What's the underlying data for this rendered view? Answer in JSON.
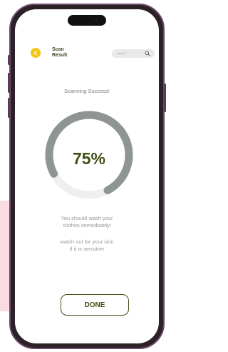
{
  "header": {
    "title_line1": "Scan",
    "title_line2": "Result",
    "search_placeholder": "search"
  },
  "status_text": "Scanning Success!",
  "progress": {
    "percent": 75,
    "label": "75%",
    "track_color": "#efefef",
    "fill_color": "#8f9594"
  },
  "messages": {
    "line1": "You should wash your",
    "line2": "clothes immediately!",
    "line3": "watch out for your skin",
    "line4": "if it is sensitive"
  },
  "done_label": "DONE",
  "icons": {
    "back": "chevron-left-icon",
    "search": "search-icon"
  },
  "colors": {
    "accent_yellow": "#f5c518",
    "brand_olive": "#414f17",
    "phone_frame": "#6d4a68"
  }
}
